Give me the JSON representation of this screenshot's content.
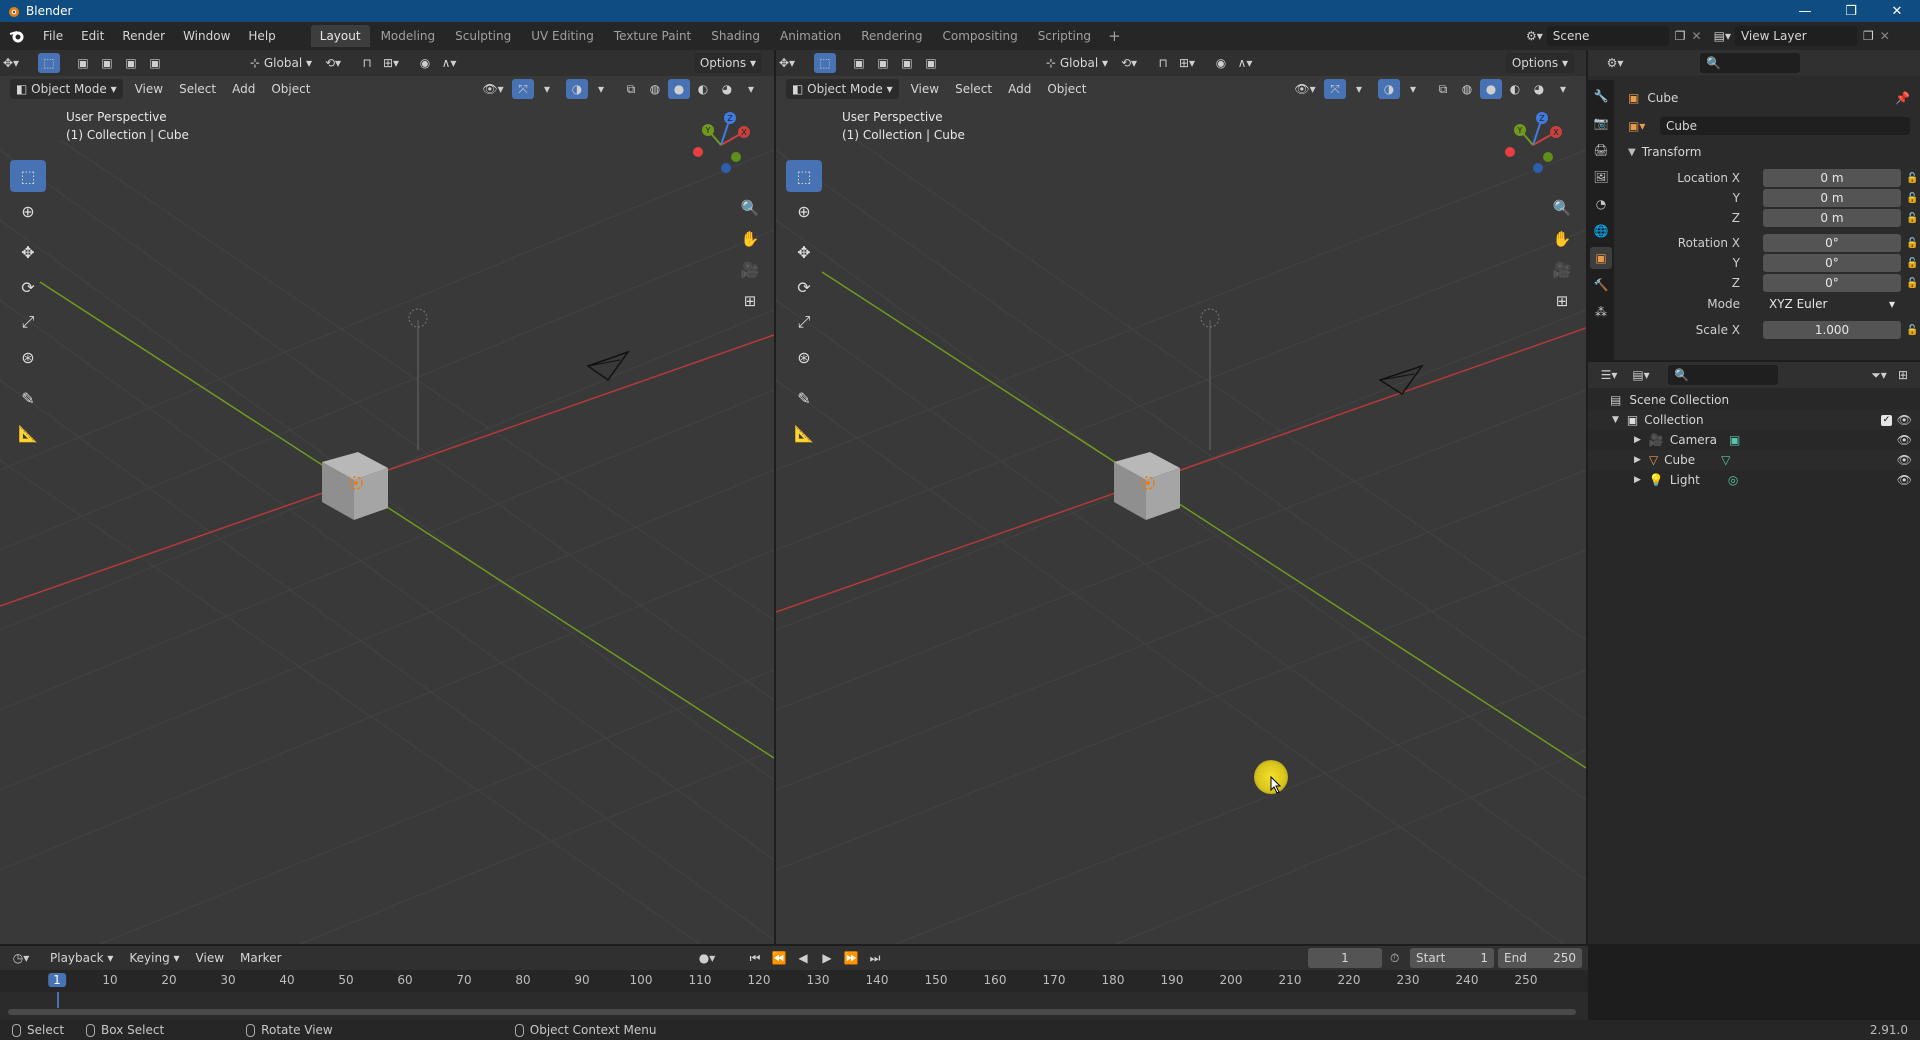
{
  "window": {
    "title": "Blender",
    "controls": [
      "—",
      "❐",
      "✕"
    ]
  },
  "menu": [
    "File",
    "Edit",
    "Render",
    "Window",
    "Help"
  ],
  "workspaces": [
    "Layout",
    "Modeling",
    "Sculpting",
    "UV Editing",
    "Texture Paint",
    "Shading",
    "Animation",
    "Rendering",
    "Compositing",
    "Scripting"
  ],
  "active_workspace": "Layout",
  "scene": {
    "label": "Scene",
    "view_layer": "View Layer"
  },
  "viewport_left": {
    "orientation": "Global",
    "options": "Options",
    "mode": "Object Mode",
    "menus": [
      "View",
      "Select",
      "Add",
      "Object"
    ],
    "overlay_title": "User Perspective",
    "overlay_sub": "(1) Collection | Cube"
  },
  "viewport_right": {
    "orientation": "Global",
    "options": "Options",
    "mode": "Object Mode",
    "menus": [
      "View",
      "Select",
      "Add",
      "Object"
    ],
    "overlay_title": "User Perspective",
    "overlay_sub": "(1) Collection | Cube"
  },
  "gizmo_axes": {
    "x": "X",
    "y": "Y",
    "z": "Z"
  },
  "properties": {
    "object_name": "Cube",
    "datablock_name": "Cube",
    "section": "Transform",
    "location_x_label": "Location X",
    "location_x": "0 m",
    "y_label": "Y",
    "location_y": "0 m",
    "z_label": "Z",
    "location_z": "0 m",
    "rotation_x_label": "Rotation X",
    "rotation_x": "0°",
    "rotation_y": "0°",
    "rotation_z": "0°",
    "mode_label": "Mode",
    "mode_value": "XYZ Euler",
    "scale_x_label": "Scale X",
    "scale_x": "1.000"
  },
  "outliner": {
    "scene_collection": "Scene Collection",
    "collection": "Collection",
    "items": [
      {
        "name": "Camera",
        "icon_color": "#e59a4c"
      },
      {
        "name": "Cube",
        "icon_color": "#e59a4c"
      },
      {
        "name": "Light",
        "icon_color": "#e59a4c"
      }
    ]
  },
  "timeline": {
    "menus": [
      "Playback",
      "Keying",
      "View",
      "Marker"
    ],
    "current_frame": "1",
    "start_label": "Start",
    "start": "1",
    "end_label": "End",
    "end": "250",
    "ruler": [
      "1",
      "10",
      "20",
      "30",
      "40",
      "50",
      "60",
      "70",
      "80",
      "90",
      "100",
      "110",
      "120",
      "130",
      "140",
      "150",
      "160",
      "170",
      "180",
      "190",
      "200",
      "210",
      "220",
      "230",
      "240",
      "250"
    ]
  },
  "status": {
    "select": "Select",
    "box_select": "Box Select",
    "rotate_view": "Rotate View",
    "context_menu": "Object Context Menu",
    "version": "2.91.0"
  },
  "colors": {
    "accent": "#4772b3",
    "title_bar": "#0f4c81",
    "x_axis": "#c8413f",
    "y_axis": "#6f9a1f",
    "z_axis": "#3f7be0"
  }
}
